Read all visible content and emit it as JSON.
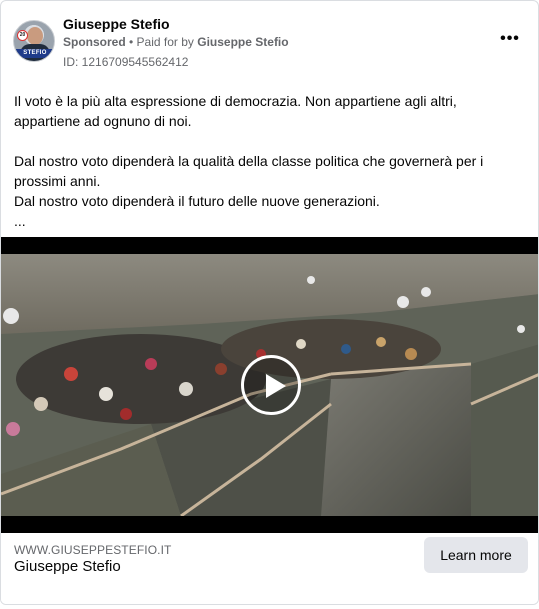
{
  "header": {
    "page_name": "Giuseppe Stefio",
    "sponsored_label": "Sponsored",
    "separator": " • ",
    "paid_for_prefix": "Paid for by ",
    "payer": "Giuseppe Stefio",
    "ad_id": "ID: 1216709545562412",
    "more_icon": "more-horizontal-icon",
    "more_glyph": "•••",
    "avatar_badge": "STEFIO",
    "avatar_number": "20"
  },
  "body": {
    "paragraph_1": "Il voto è la più alta espressione di democrazia. Non appartiene agli altri, appartiene ad ognuno di noi.",
    "paragraph_2_line_1": "Dal nostro voto dipenderà la qualità della classe politica che governerà per i prossimi anni.",
    "paragraph_2_line_2": "Dal nostro voto dipenderà il futuro delle nuove generazioni.",
    "truncation": "..."
  },
  "video": {
    "play_icon": "play-icon"
  },
  "footer": {
    "domain": "WWW.GIUSEPPESTEFIO.IT",
    "title": "Giuseppe Stefio",
    "cta_label": "Learn more"
  },
  "colors": {
    "secondary_text": "#65676b",
    "primary_text": "#050505",
    "button_bg": "#e4e6eb",
    "border": "#dadde1"
  }
}
